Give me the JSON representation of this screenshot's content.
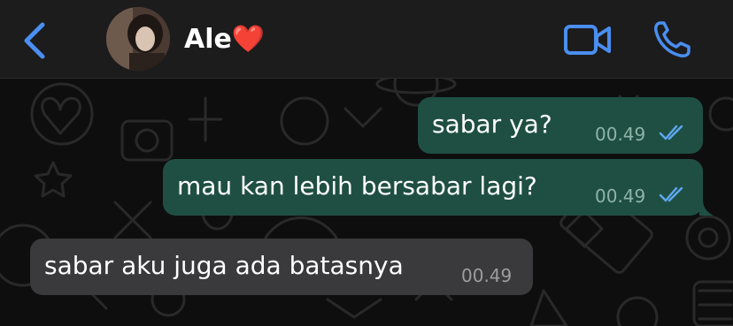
{
  "header": {
    "contact_name": "Ale❤️"
  },
  "messages": [
    {
      "direction": "outgoing",
      "text": "sabar ya?",
      "time": "00.49",
      "status": "read"
    },
    {
      "direction": "outgoing",
      "text": "mau kan lebih bersabar lagi?",
      "time": "00.49",
      "status": "read"
    },
    {
      "direction": "incoming",
      "text": "sabar aku juga ada batasnya",
      "time": "00.49"
    }
  ],
  "colors": {
    "accent": "#4a8ef0",
    "outgoing_bubble": "#1f4f43",
    "incoming_bubble": "#3a3a3c",
    "read_ticks": "#5fa9f2"
  },
  "icons": {
    "back": "chevron-left-icon",
    "video": "video-camera-icon",
    "call": "phone-icon",
    "read_status": "double-check-icon"
  }
}
